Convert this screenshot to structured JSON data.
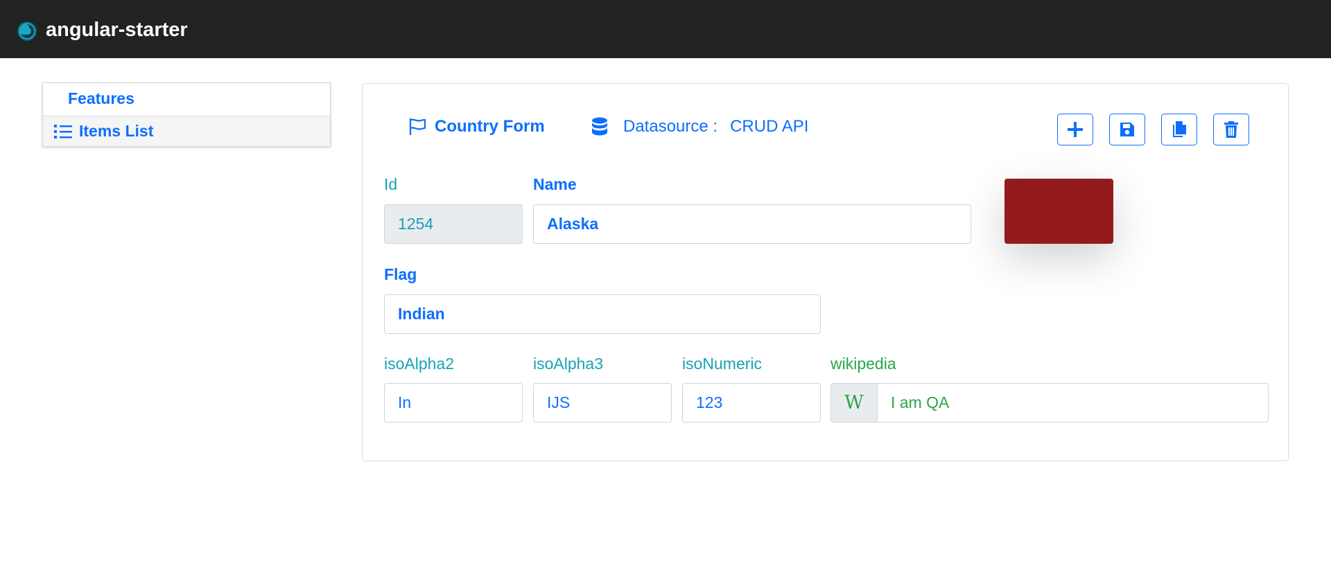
{
  "app": {
    "title": "angular-starter"
  },
  "sidebar": {
    "header": "Features",
    "items": [
      {
        "label": "Items List",
        "icon": "list-icon"
      }
    ]
  },
  "form": {
    "title": "Country Form",
    "datasource_label": "Datasource :",
    "datasource_value": "CRUD API",
    "toolbar": {
      "add": "plus-icon",
      "save": "floppy-disk-icon",
      "copy": "copy-icon",
      "delete": "trash-icon"
    },
    "fields": {
      "id": {
        "label": "Id",
        "value": "1254"
      },
      "name": {
        "label": "Name",
        "value": "Alaska"
      },
      "flag": {
        "label": "Flag",
        "value": "Indian"
      },
      "isoAlpha2": {
        "label": "isoAlpha2",
        "value": "In"
      },
      "isoAlpha3": {
        "label": "isoAlpha3",
        "value": "IJS"
      },
      "isoNumeric": {
        "label": "isoNumeric",
        "value": "123"
      },
      "wikipedia": {
        "label": "wikipedia",
        "addon": "W",
        "value": "I am QA"
      }
    },
    "flag_preview_color": "#931b1b"
  },
  "colors": {
    "navbar": "#222222",
    "primary": "#0d6efd",
    "teal": "#17a2b8",
    "green": "#28a745"
  }
}
